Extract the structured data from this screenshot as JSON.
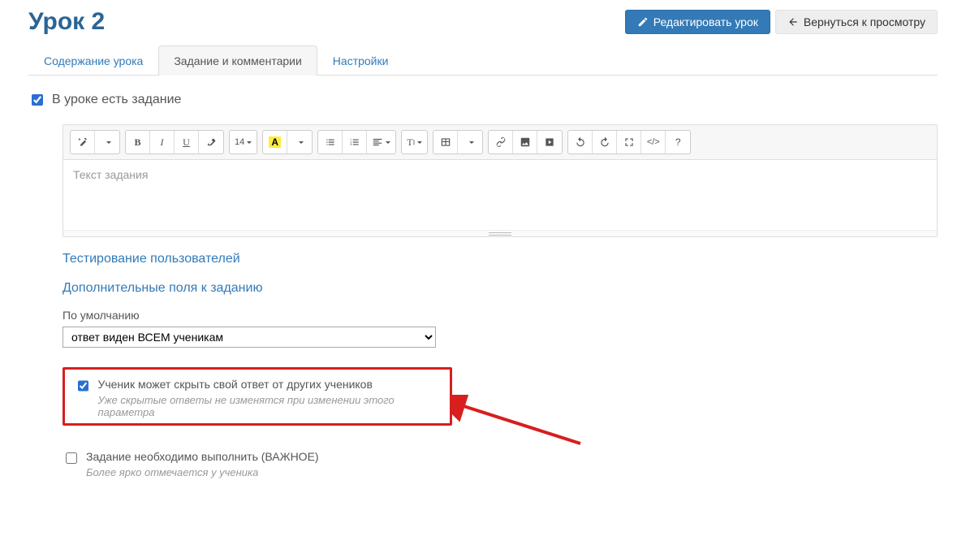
{
  "header": {
    "title": "Урок 2",
    "edit_btn": "Редактировать урок",
    "back_btn": "Вернуться к просмотру"
  },
  "tabs": {
    "content": "Содержание урока",
    "task": "Задание и комментарии",
    "settings": "Настройки"
  },
  "task_section": {
    "has_task_label": "В уроке есть задание",
    "editor_placeholder": "Текст задания",
    "font_size": "14",
    "test_users_link": "Тестирование пользователей",
    "extra_fields_link": "Дополнительные поля к заданию",
    "default_label": "По умолчанию",
    "visibility_option": "ответ виден ВСЕМ ученикам",
    "student_hide": {
      "label": "Ученик может скрыть свой ответ от других учеников",
      "hint": "Уже скрытые ответы не изменятся при изменении этого параметра"
    },
    "important": {
      "label": "Задание необходимо выполнить (ВАЖНОЕ)",
      "hint": "Более ярко отмечается у ученика"
    }
  }
}
